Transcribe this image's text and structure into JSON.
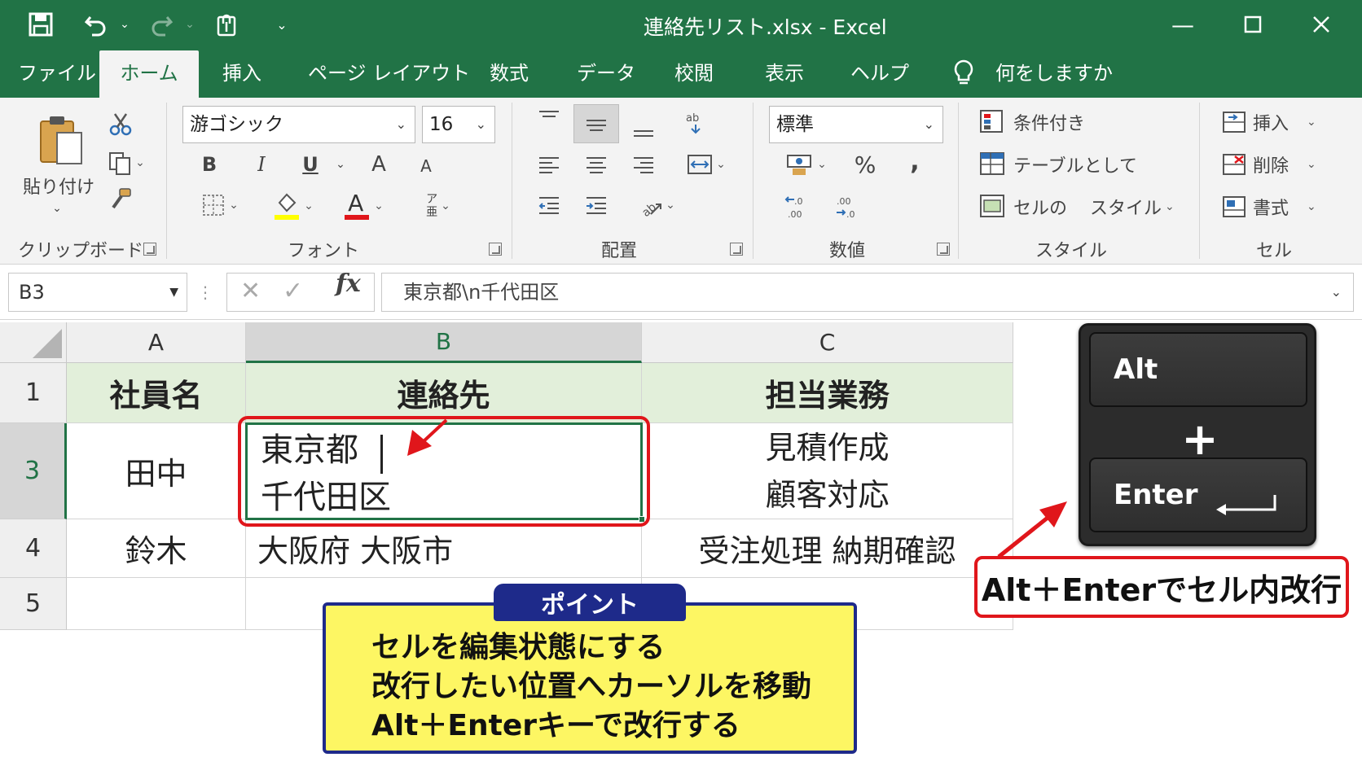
{
  "window": {
    "title": "連絡先リスト.xlsx  -  Excel",
    "accent_color": "#217346",
    "quick_access": [
      "save-icon",
      "undo-icon",
      "redo-icon",
      "touch-mode-icon",
      "customize-icon"
    ],
    "controls": [
      "minimize-icon",
      "restore-icon",
      "close-icon"
    ]
  },
  "ribbon": {
    "tabs": [
      "ファイル",
      "ホーム",
      "挿入",
      "ページ レイアウト",
      "数式",
      "データ",
      "校閲",
      "表示",
      "ヘルプ"
    ],
    "active_tab": "ホーム",
    "tell_me": "何をしますか",
    "clipboard": {
      "paste_label": "貼り付け",
      "group_label": "クリップボード"
    },
    "font": {
      "family": "游ゴシック",
      "size": "16",
      "group_label": "フォント",
      "bold": "B",
      "italic": "I",
      "underline": "U",
      "grow": "A",
      "shrink": "A",
      "font_color_glyph": "A",
      "phonetic_top": "ア",
      "phonetic_bottom": "亜",
      "highlight_color": "#ffff00",
      "font_color": "#e0161b"
    },
    "alignment": {
      "group_label": "配置"
    },
    "number": {
      "format": "標準",
      "percent": "%",
      "comma": ",",
      "group_label": "数値"
    },
    "styles": {
      "conditional": "条件付き",
      "as_table": "テーブルとして",
      "cell_styles_1": "セルの",
      "cell_styles_2": "スタイル",
      "group_label": "スタイル"
    },
    "cells": {
      "insert": "挿入",
      "delete": "削除",
      "format": "書式",
      "group_label": "セル"
    }
  },
  "formula_bar": {
    "name_box": "B3",
    "fx": "fx",
    "content": "東京都\\n千代田区"
  },
  "sheet": {
    "columns": [
      "A",
      "B",
      "C"
    ],
    "selected_column": "B",
    "rows": [
      "1",
      "3",
      "4",
      "5"
    ],
    "selected_row": "3",
    "header_fill": "#e2efda",
    "headers": {
      "A": "社員名",
      "B": "連絡先",
      "C": "担当業務"
    },
    "row3": {
      "A": "田中",
      "B_line1": "東京都",
      "B_line2": "千代田区",
      "C_line1": "見積作成",
      "C_line2": "顧客対応"
    },
    "row4": {
      "A": "鈴木",
      "B": "大阪府 大阪市",
      "C": "受注処理 納期確認"
    }
  },
  "key_hint": {
    "key1": "Alt",
    "plus": "+",
    "key2": "Enter",
    "caption": "Alt＋Enterでセル内改行"
  },
  "point": {
    "title": "ポイント",
    "lines": [
      "セルを編集状態にする",
      "改行したい位置へカーソルを移動",
      "Alt＋Enterキーで改行する"
    ],
    "fill": "#fdf663",
    "border": "#1e2a8a"
  },
  "highlight_color": "#e0161b"
}
